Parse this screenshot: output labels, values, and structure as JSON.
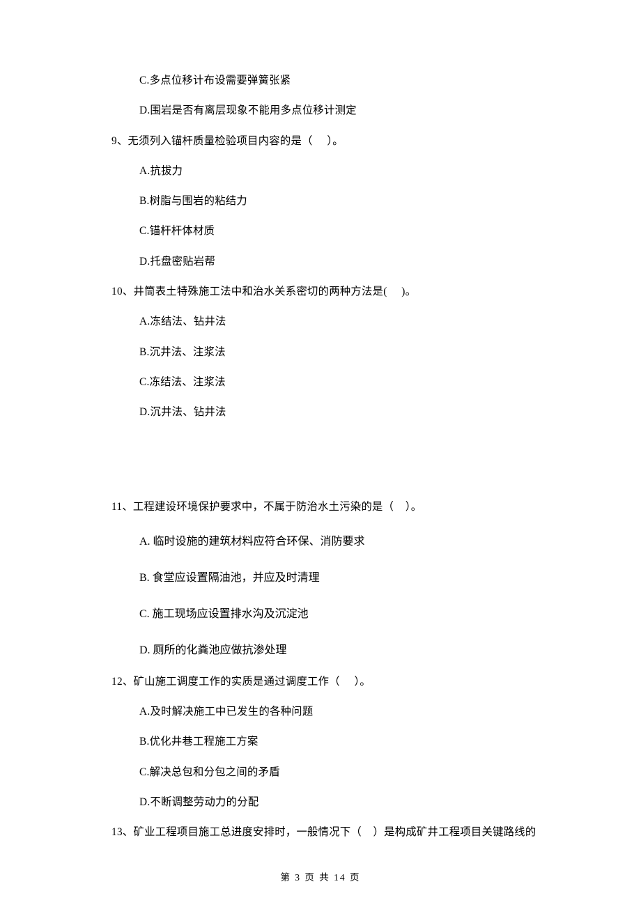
{
  "prefix_options": {
    "c": "C.多点位移计布设需要弹簧张紧",
    "d": "D.围岩是否有离层现象不能用多点位移计测定"
  },
  "q9": {
    "stem": "9、无须列入锚杆质量检验项目内容的是（     ）。",
    "a": "A.抗拔力",
    "b": "B.树脂与围岩的粘结力",
    "c": "C.锚杆杆体材质",
    "d": "D.托盘密贴岩帮"
  },
  "q10": {
    "stem": "10、井筒表土特殊施工法中和治水关系密切的两种方法是(     )。",
    "a": "A.冻结法、钻井法",
    "b": "B.沉井法、注浆法",
    "c": "C.冻结法、注浆法",
    "d": "D.沉井法、钻井法"
  },
  "q11": {
    "stem": "11、工程建设环境保护要求中，不属于防治水土污染的是（    ）。",
    "a": "A.  临时设施的建筑材料应符合环保、消防要求",
    "b": "B.  食堂应设置隔油池，并应及时清理",
    "c": "C.  施工现场应设置排水沟及沉淀池",
    "d": "D.  厕所的化粪池应做抗渗处理"
  },
  "q12": {
    "stem": "12、矿山施工调度工作的实质是通过调度工作（     ）。",
    "a": "A.及时解决施工中已发生的各种问题",
    "b": "B.优化井巷工程施工方案",
    "c": "C.解决总包和分包之间的矛盾",
    "d": "D.不断调整劳动力的分配"
  },
  "q13": {
    "stem": "13、矿业工程项目施工总进度安排时，一般情况下（    ）是构成矿井工程项目关键路线的"
  },
  "footer": "第 3 页 共 14 页"
}
